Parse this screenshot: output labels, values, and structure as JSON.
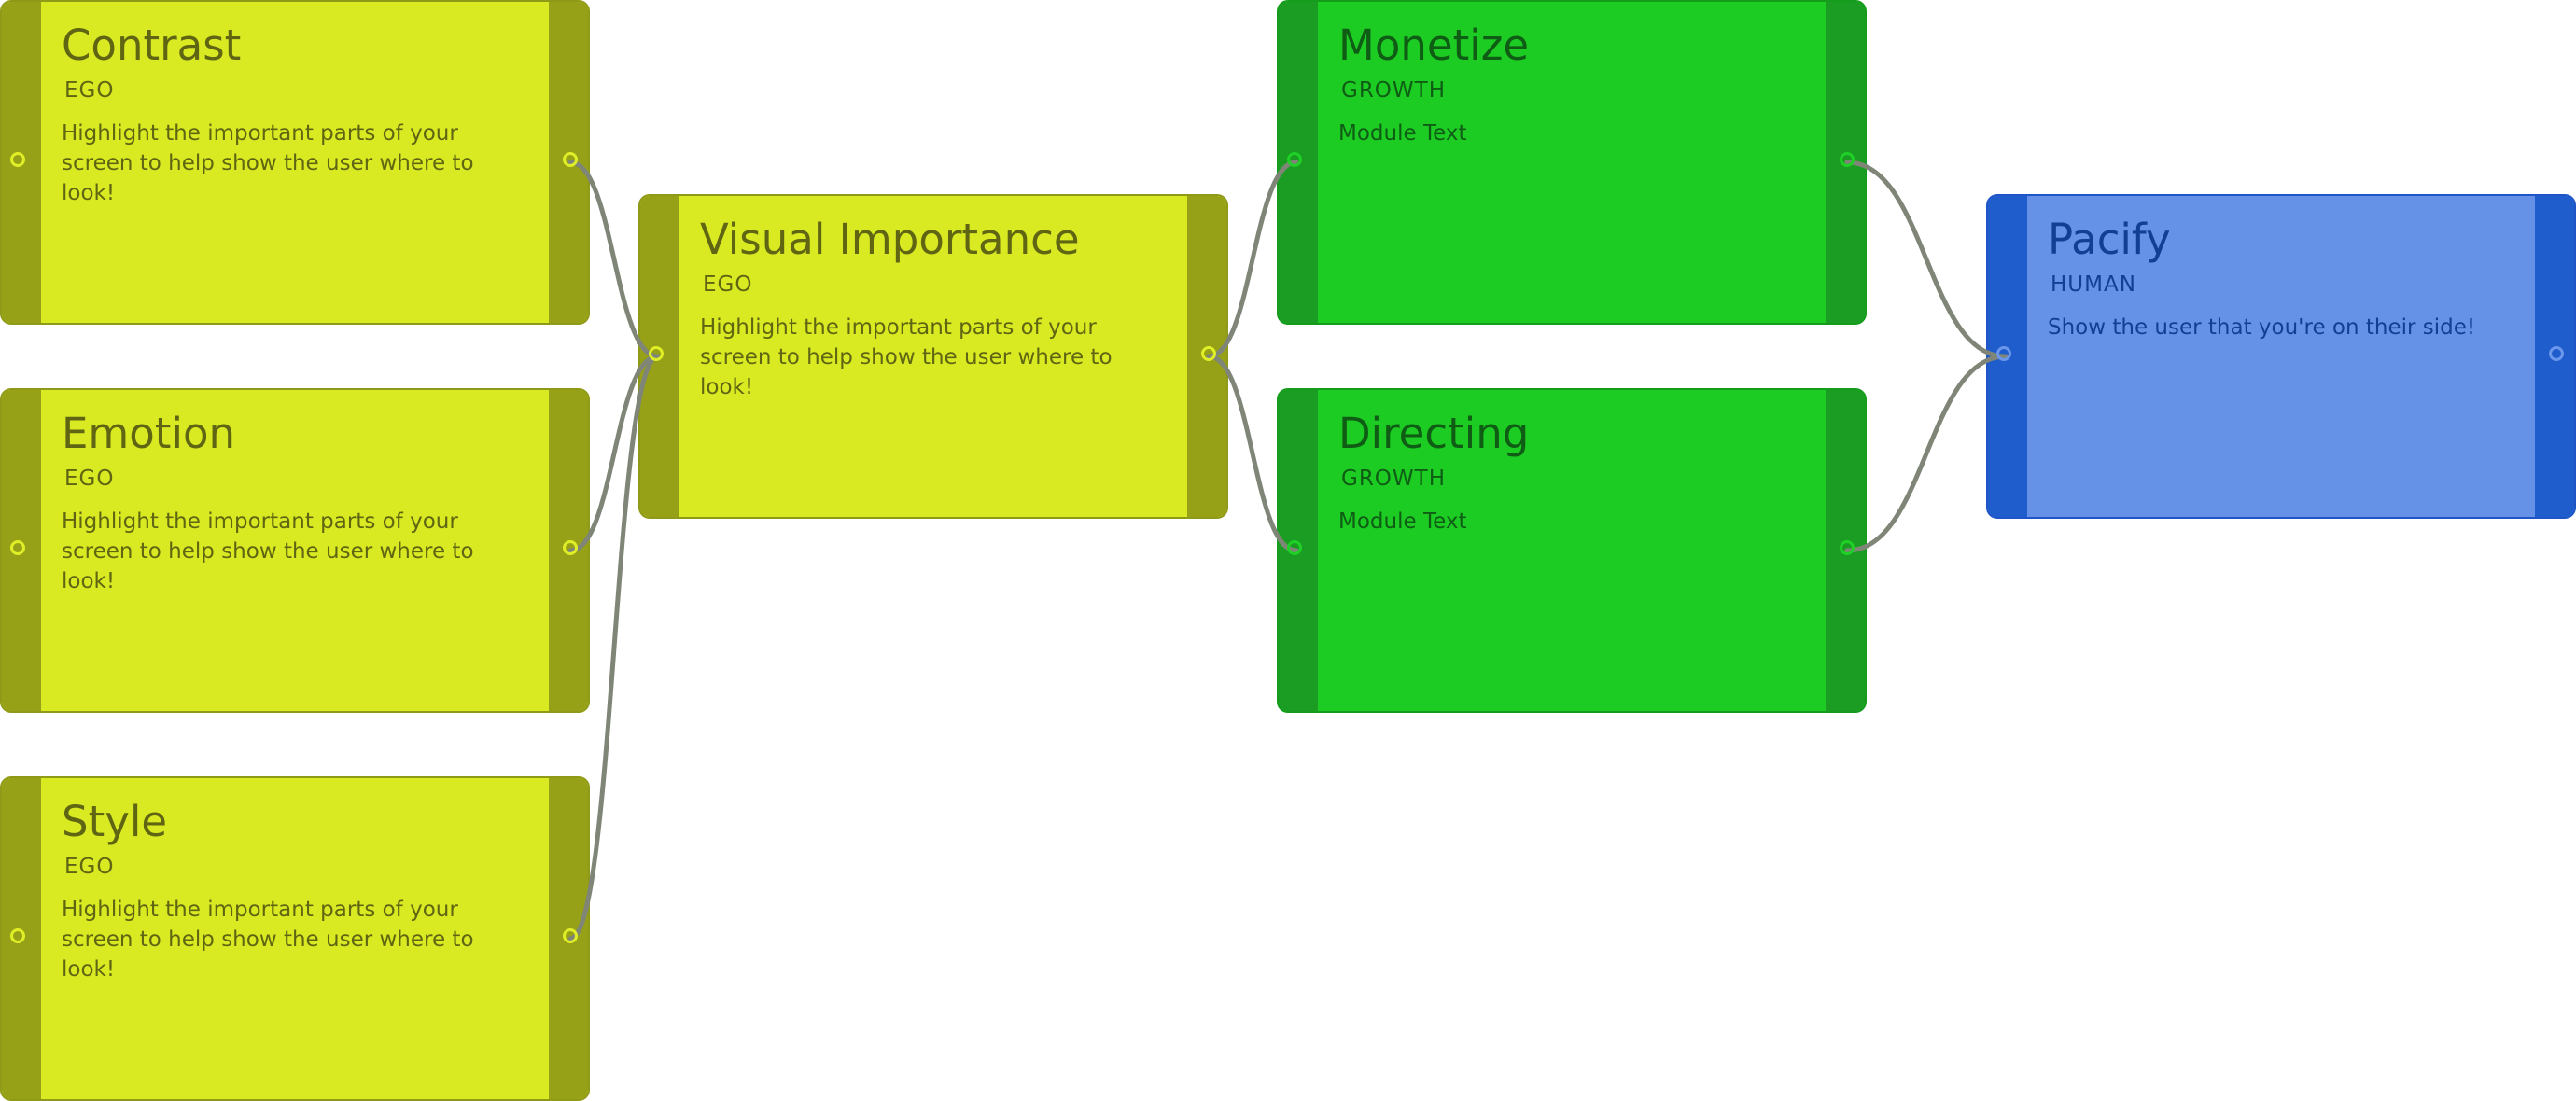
{
  "nodes": {
    "contrast": {
      "title": "Contrast",
      "tag": "EGO",
      "text": "Highlight the important parts of your screen to help show the user where to look!"
    },
    "emotion": {
      "title": "Emotion",
      "tag": "EGO",
      "text": "Highlight the important parts of your screen to help show the user where to look!"
    },
    "style": {
      "title": "Style",
      "tag": "EGO",
      "text": "Highlight the important parts of your screen to help show the user where to look!"
    },
    "visual_importance": {
      "title": "Visual Importance",
      "tag": "EGO",
      "text": "Highlight the important parts of your screen to help show the user where to look!"
    },
    "monetize": {
      "title": "Monetize",
      "tag": "GROWTH",
      "text": "Module Text"
    },
    "directing": {
      "title": "Directing",
      "tag": "GROWTH",
      "text": "Module Text"
    },
    "pacify": {
      "title": "Pacify",
      "tag": "HUMAN",
      "text": "Show the user that you're on their side!"
    }
  },
  "connections": [
    {
      "from": "contrast",
      "to": "visual_importance"
    },
    {
      "from": "emotion",
      "to": "visual_importance"
    },
    {
      "from": "style",
      "to": "visual_importance"
    },
    {
      "from": "visual_importance",
      "to": "monetize"
    },
    {
      "from": "visual_importance",
      "to": "directing"
    },
    {
      "from": "monetize",
      "to": "pacify"
    },
    {
      "from": "directing",
      "to": "pacify"
    }
  ],
  "colors": {
    "ego": "#d9ea22",
    "growth": "#1ccc22",
    "human": "#6591e6",
    "wire": "#7f8677"
  }
}
